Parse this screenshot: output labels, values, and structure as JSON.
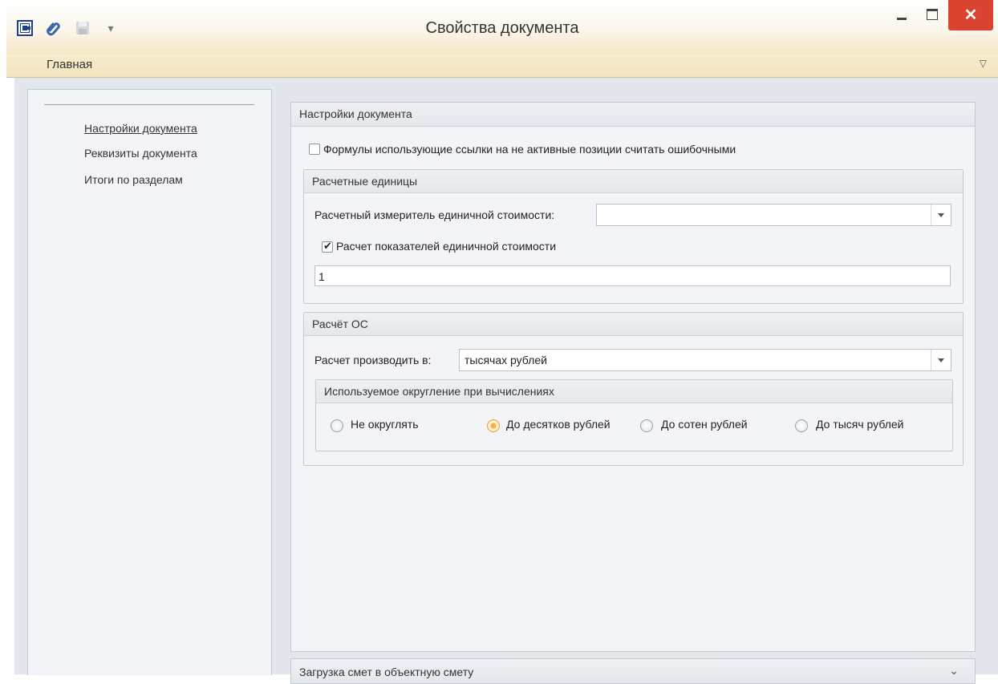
{
  "window": {
    "title": "Свойства документа",
    "close_glyph": "✕",
    "quick_access_more": "▾"
  },
  "ribbon": {
    "tab": "Главная",
    "collapse_glyph": "▽"
  },
  "nav": {
    "items": [
      "Настройки документа",
      "Реквизиты документа",
      "Итоги по разделам"
    ]
  },
  "settings": {
    "header": "Настройки документа",
    "formulas_checkbox_label": "Формулы использующие ссылки на не активные позиции считать ошибочными",
    "formulas_checked": false,
    "units": {
      "header": "Расчетные единицы",
      "meter_label": "Расчетный измеритель единичной стоимости:",
      "meter_value": "",
      "unit_calc_label": "Расчет показателей единичной стоимости",
      "unit_calc_checked": true,
      "value": "1"
    },
    "os": {
      "header": "Расчёт ОС",
      "calc_in_label": "Расчет производить в:",
      "calc_in_value": "тысячах рублей",
      "rounding": {
        "header": "Используемое округление при вычислениях",
        "options": [
          "Не округлять",
          "До десятков рублей",
          "До сотен рублей",
          "До тысяч рублей"
        ],
        "selected": "До десятков рублей"
      }
    }
  },
  "bottom_panel": {
    "title": "Загрузка смет в объектную смету",
    "chevron_glyph": "⌄"
  },
  "colors": {
    "accent": "#f7b043",
    "close_button": "#d9432f"
  }
}
